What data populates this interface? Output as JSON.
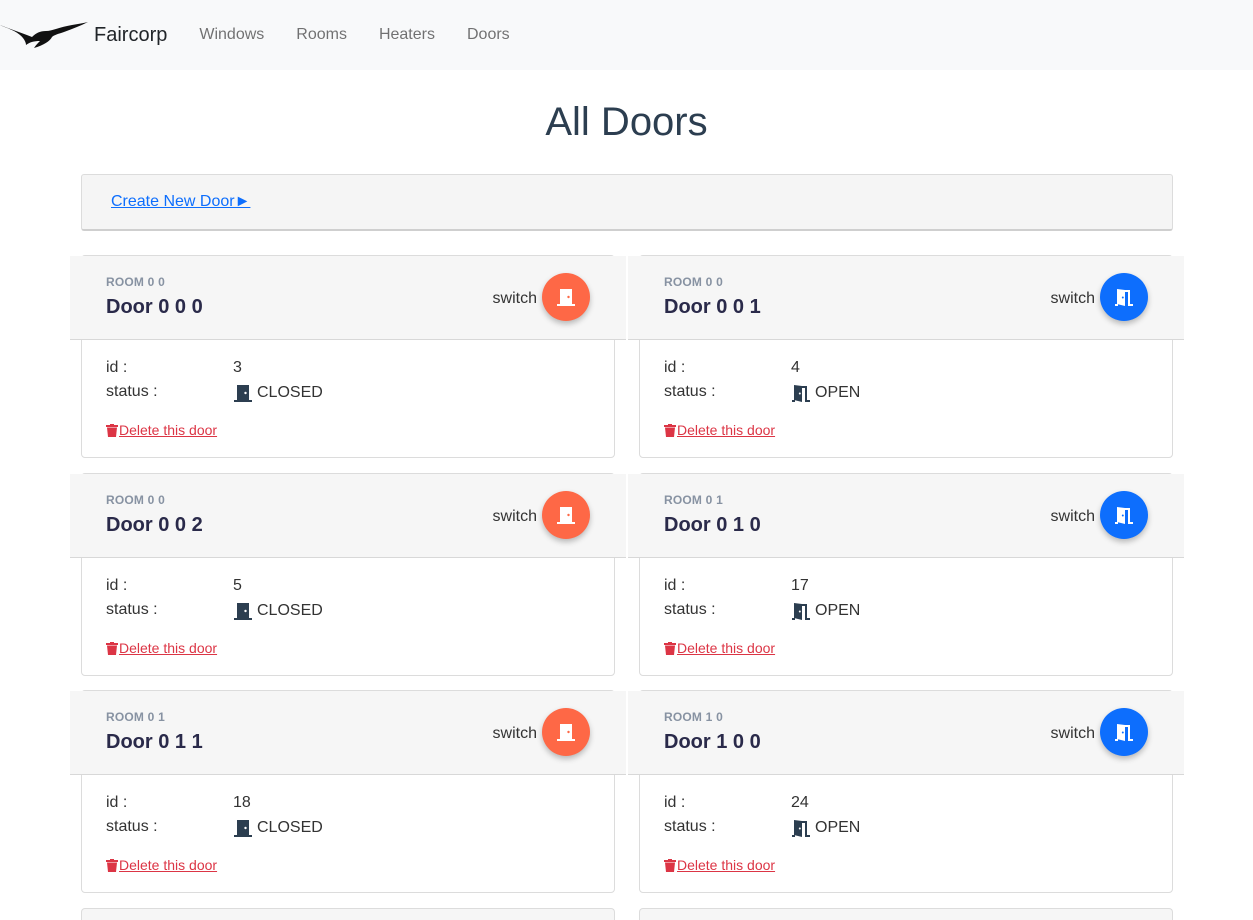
{
  "nav": {
    "brand": "Faircorp",
    "links": [
      "Windows",
      "Rooms",
      "Heaters",
      "Doors"
    ]
  },
  "page": {
    "title": "All Doors",
    "create_link": "Create New Door►"
  },
  "card_labels": {
    "switch": "switch",
    "id": "id :",
    "status": "status :",
    "delete": "Delete this door"
  },
  "doors": [
    {
      "room": "ROOM 0 0",
      "name": "Door 0 0 0",
      "id": "3",
      "status": "CLOSED"
    },
    {
      "room": "ROOM 0 0",
      "name": "Door 0 0 1",
      "id": "4",
      "status": "OPEN"
    },
    {
      "room": "ROOM 0 0",
      "name": "Door 0 0 2",
      "id": "5",
      "status": "CLOSED"
    },
    {
      "room": "ROOM 0 1",
      "name": "Door 0 1 0",
      "id": "17",
      "status": "OPEN"
    },
    {
      "room": "ROOM 0 1",
      "name": "Door 0 1 1",
      "id": "18",
      "status": "CLOSED"
    },
    {
      "room": "ROOM 1 0",
      "name": "Door 1 0 0",
      "id": "24",
      "status": "OPEN"
    }
  ],
  "icons": {
    "closed": "door-closed-icon",
    "open": "door-open-icon",
    "delete": "trash-icon",
    "logo": "bird-logo-icon"
  },
  "colors": {
    "closed_button": "#fe6846",
    "open_button": "#0d6efd",
    "delete": "#dc3545",
    "link": "#0d6efd"
  }
}
